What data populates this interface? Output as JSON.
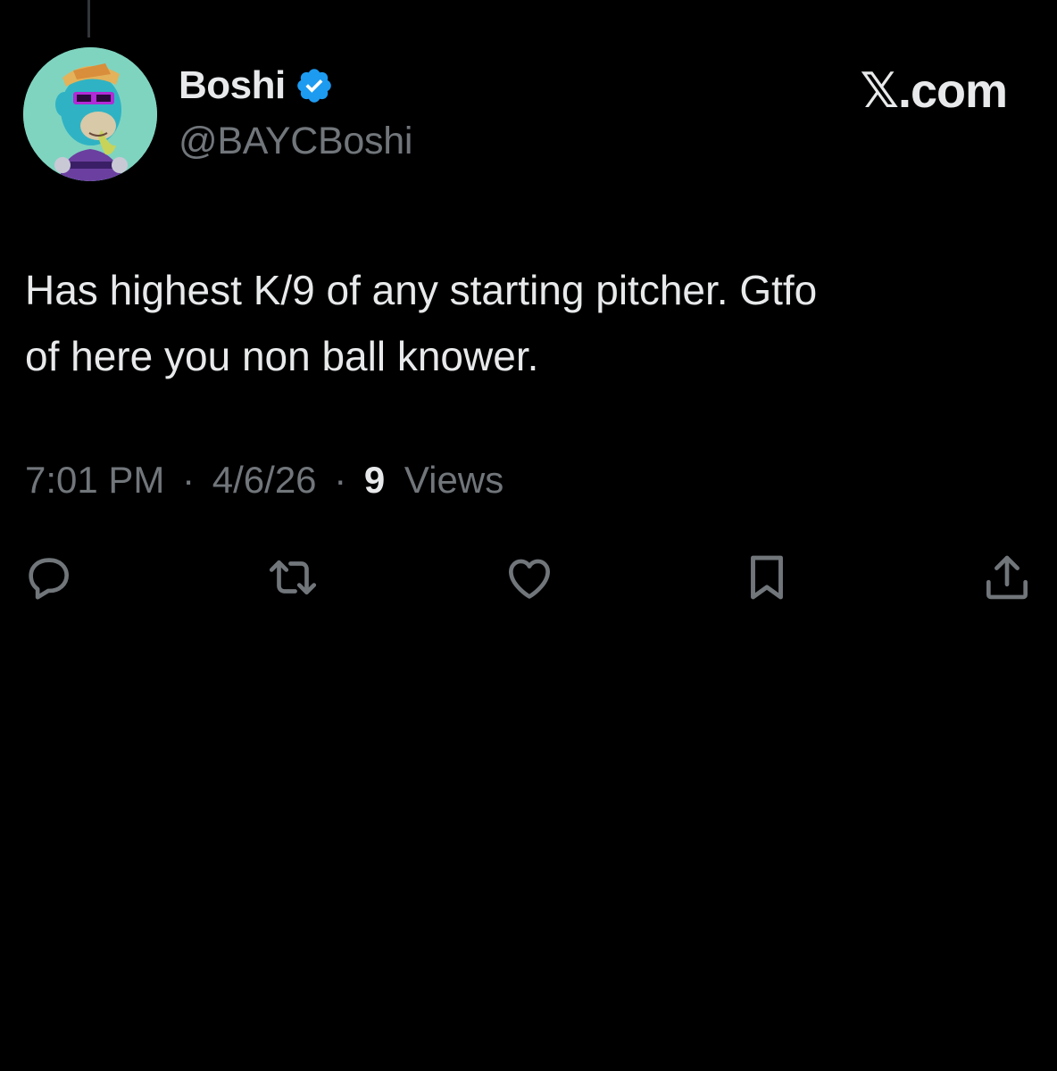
{
  "tweet": {
    "author": {
      "display_name": "Boshi",
      "handle": "@BAYCBoshi",
      "verified": true,
      "avatar_icon": "ape-avatar-icon"
    },
    "brand": "𝕏.com",
    "text_lines": [
      "Has highest K/9 of any starting pitcher. Gtfo",
      "of here you non ball knower."
    ],
    "meta": {
      "time": "7:01 PM",
      "separator": "·",
      "date": "4/6/26",
      "views_count": "9",
      "views_label": "Views"
    },
    "actions": [
      {
        "name": "reply",
        "icon": "reply-icon"
      },
      {
        "name": "retweet",
        "icon": "retweet-icon"
      },
      {
        "name": "like",
        "icon": "heart-icon"
      },
      {
        "name": "bookmark",
        "icon": "bookmark-icon"
      },
      {
        "name": "share",
        "icon": "share-icon"
      }
    ]
  },
  "colors": {
    "background": "#000000",
    "primary_text": "#e7e9ea",
    "secondary_text": "#71767b",
    "verified_badge": "#1d9bf0"
  }
}
